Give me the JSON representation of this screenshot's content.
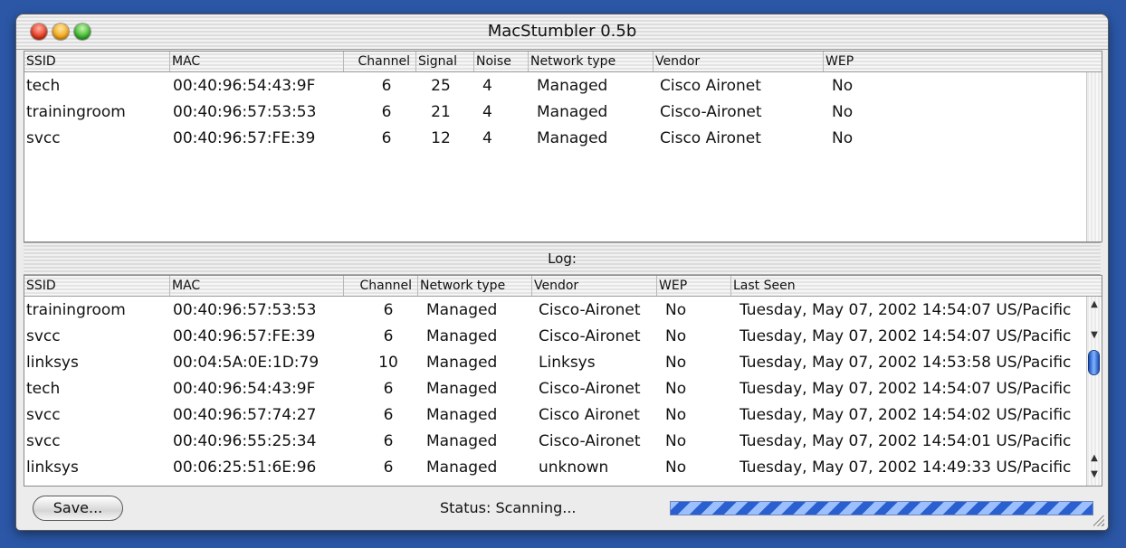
{
  "window": {
    "title": "MacStumbler 0.5b"
  },
  "networks": {
    "columns": [
      "SSID",
      "MAC",
      "Channel",
      "Signal",
      "Noise",
      "Network type",
      "Vendor",
      "WEP"
    ],
    "rows": [
      [
        "tech",
        "00:40:96:54:43:9F",
        "6",
        "25",
        "4",
        "Managed",
        "Cisco Aironet",
        "No"
      ],
      [
        "trainingroom",
        "00:40:96:57:53:53",
        "6",
        "21",
        "4",
        "Managed",
        "Cisco-Aironet",
        "No"
      ],
      [
        "svcc",
        "00:40:96:57:FE:39",
        "6",
        "12",
        "4",
        "Managed",
        "Cisco Aironet",
        "No"
      ]
    ]
  },
  "log": {
    "label": "Log:",
    "columns": [
      "SSID",
      "MAC",
      "Channel",
      "Network type",
      "Vendor",
      "WEP",
      "Last Seen"
    ],
    "rows": [
      [
        "trainingroom",
        "00:40:96:57:53:53",
        "6",
        "Managed",
        "Cisco-Aironet",
        "No",
        "Tuesday, May 07, 2002 14:54:07 US/Pacific"
      ],
      [
        "svcc",
        "00:40:96:57:FE:39",
        "6",
        "Managed",
        "Cisco-Aironet",
        "No",
        "Tuesday, May 07, 2002 14:54:07 US/Pacific"
      ],
      [
        "linksys",
        "00:04:5A:0E:1D:79",
        "10",
        "Managed",
        "Linksys",
        "No",
        "Tuesday, May 07, 2002 14:53:58 US/Pacific"
      ],
      [
        "tech",
        "00:40:96:54:43:9F",
        "6",
        "Managed",
        "Cisco-Aironet",
        "No",
        "Tuesday, May 07, 2002 14:54:07 US/Pacific"
      ],
      [
        "svcc",
        "00:40:96:57:74:27",
        "6",
        "Managed",
        "Cisco Aironet",
        "No",
        "Tuesday, May 07, 2002 14:54:02 US/Pacific"
      ],
      [
        "svcc",
        "00:40:96:55:25:34",
        "6",
        "Managed",
        "Cisco-Aironet",
        "No",
        "Tuesday, May 07, 2002 14:54:01 US/Pacific"
      ],
      [
        "linksys",
        "00:06:25:51:6E:96",
        "6",
        "Managed",
        "unknown",
        "No",
        "Tuesday, May 07, 2002 14:49:33 US/Pacific"
      ]
    ]
  },
  "footer": {
    "save_label": "Save...",
    "status": "Status: Scanning...",
    "progress_fraction": 1.0
  },
  "icons": {
    "close": "close-icon",
    "minimize": "minimize-icon",
    "zoom": "zoom-icon",
    "scroll_up": "scroll-up-arrow-icon",
    "scroll_down": "scroll-down-arrow-icon",
    "resize": "resize-grip-icon"
  },
  "colors": {
    "desktop": "#2b57a6",
    "progress": "#2a5fd0"
  }
}
